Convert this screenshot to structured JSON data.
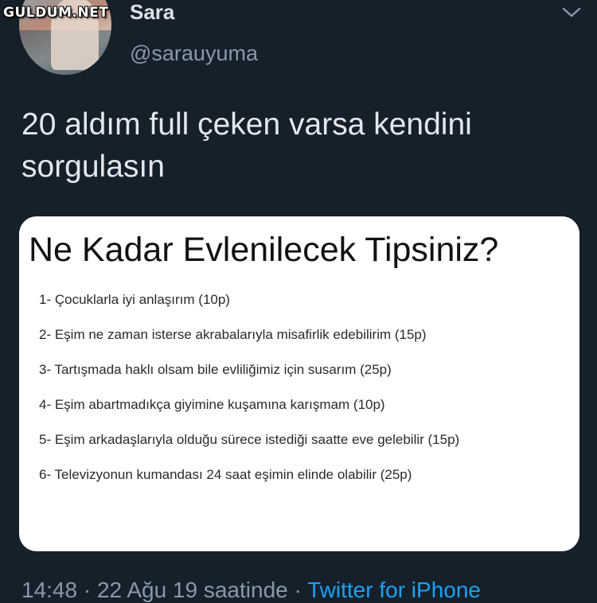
{
  "watermark": "GULDUM.NET",
  "tweet": {
    "author_name": "Sara",
    "author_handle": "@sarauyuma",
    "text": "20 aldım full çeken varsa kendini sorgulasın"
  },
  "card": {
    "title": "Ne Kadar Evlenilecek Tipsiniz?",
    "items": [
      "1- Çocuklarla iyi anlaşırım (10p)",
      "2- Eşim ne zaman isterse akrabalarıyla misafirlik edebilirim (15p)",
      "3- Tartışmada haklı olsam bile evliliğimiz için susarım (25p)",
      "4- Eşim abartmadıkça giyimine kuşamına karışmam (10p)",
      "5- Eşim arkadaşlarıyla olduğu sürece istediği saatte eve gelebilir (15p)",
      "6- Televizyonun kumandası 24 saat eşimin elinde olabilir (25p)"
    ]
  },
  "footer": {
    "timestamp": "14:48 · 22 Ağu 19 saatinde ·",
    "source": "Twitter for iPhone"
  },
  "colors": {
    "background": "#15202b",
    "link": "#1da1f2",
    "muted": "#8899a6"
  },
  "icons": {
    "menu": "chevron-down-icon"
  }
}
